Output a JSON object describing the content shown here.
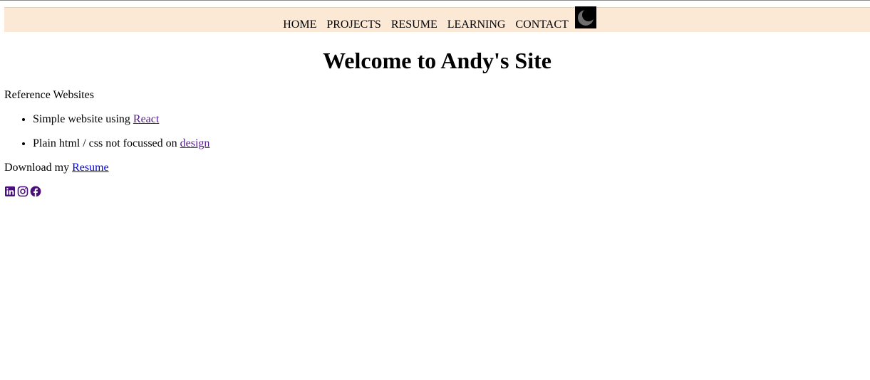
{
  "nav": {
    "items": [
      {
        "label": "HOME"
      },
      {
        "label": "PROJECTS"
      },
      {
        "label": "RESUME"
      },
      {
        "label": "LEARNING"
      },
      {
        "label": "CONTACT"
      }
    ],
    "theme_toggle_icon": "moon-icon"
  },
  "main": {
    "title": "Welcome to Andy's Site",
    "reference_heading": "Reference Websites",
    "references": [
      {
        "text": "Simple website using ",
        "link": "React"
      },
      {
        "text": "Plain html / css not focussed on ",
        "link": "design"
      }
    ],
    "download_text": "Download my ",
    "download_link": "Resume"
  },
  "socials": [
    {
      "icon": "linkedin-icon"
    },
    {
      "icon": "instagram-icon"
    },
    {
      "icon": "facebook-icon"
    }
  ],
  "colors": {
    "navbar_bg": "#fbe9d6",
    "visited_link": "#551a8b",
    "link": "#0000ee",
    "social_icon": "#4b0f7a"
  }
}
